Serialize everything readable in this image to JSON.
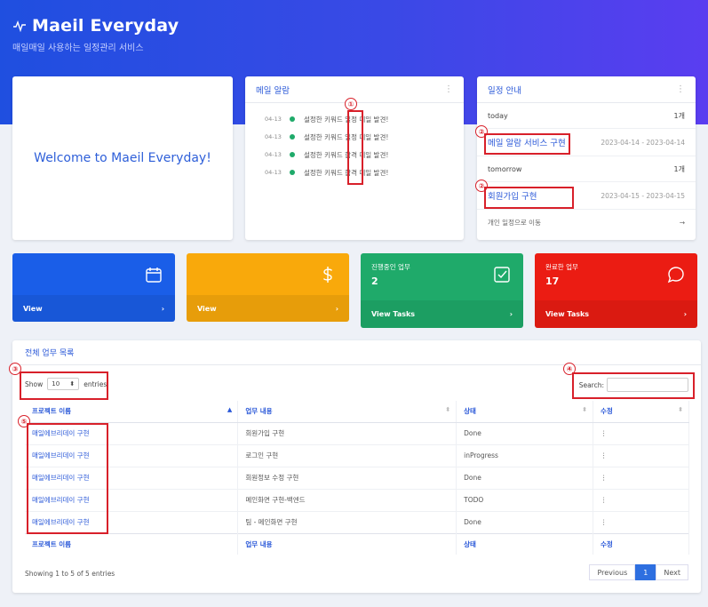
{
  "app": {
    "title": "Maeil Everyday",
    "subtitle": "매일매일 사용하는 일정관리 서비스"
  },
  "welcome": {
    "text": "Welcome to Maeil Everyday!"
  },
  "alarm": {
    "title": "메일 알람",
    "items": [
      {
        "date": "04-13",
        "before": "설정한 키워드 ",
        "keyword": "일정",
        "after": " 메일 발견!"
      },
      {
        "date": "04-13",
        "before": "설정한 키워드 ",
        "keyword": "일정",
        "after": " 메일 발견!"
      },
      {
        "date": "04-13",
        "before": "설정한 키워드 ",
        "keyword": "합격",
        "after": " 메일 발견!"
      },
      {
        "date": "04-13",
        "before": "설정한 키워드 ",
        "keyword": "합격",
        "after": " 메일 발견!"
      }
    ]
  },
  "schedule": {
    "title": "일정 안내",
    "today_label": "today",
    "today_count": "1개",
    "today_item": {
      "title": "메일 알람 서비스 구현",
      "date": "2023-04-14 - 2023-04-14"
    },
    "tomorrow_label": "tomorrow",
    "tomorrow_count": "1개",
    "tomorrow_item": {
      "title": "회원가입 구현",
      "date": "2023-04-15 - 2023-04-15"
    },
    "footer": "개인 일정으로 이동",
    "footer_arrow": "→"
  },
  "tiles": [
    {
      "color": "#1a5ee8",
      "label": "",
      "count": "",
      "view": "View",
      "icon": "calendar-icon"
    },
    {
      "color": "#f9a90b",
      "label": "",
      "count": "",
      "view": "View",
      "icon": "dollar-icon"
    },
    {
      "color": "#1faa6a",
      "label": "진행중인 업무",
      "count": "2",
      "view": "View Tasks",
      "icon": "checkbox-icon"
    },
    {
      "color": "#eb1c13",
      "label": "완료한 업무",
      "count": "17",
      "view": "View Tasks",
      "icon": "chat-icon"
    }
  ],
  "tile_chevron": "›",
  "table": {
    "title": "전체 업무 목록",
    "show_label": "Show",
    "entries_value": "10",
    "entries_label": "entries",
    "search_label": "Search:",
    "columns": [
      "프로젝트 이름",
      "업무 내용",
      "상태",
      "수정"
    ],
    "rows": [
      [
        "매일에브리데이 구현",
        "회원가입 구현",
        "Done",
        "⋮"
      ],
      [
        "매일에브리데이 구현",
        "로그인 구현",
        "inProgress",
        "⋮"
      ],
      [
        "매일에브리데이 구현",
        "회원정보 수정 구현",
        "Done",
        "⋮"
      ],
      [
        "매일에브리데이 구현",
        "메인화면 구현-백엔드",
        "TODO",
        "⋮"
      ],
      [
        "매일에브리데이 구현",
        "팀 - 메인화면 구현",
        "Done",
        "⋮"
      ]
    ],
    "info": "Showing 1 to 5 of 5 entries",
    "prev": "Previous",
    "page": "1",
    "next": "Next"
  },
  "annotations": [
    "①",
    "②",
    "②",
    "③",
    "④",
    "⑤"
  ],
  "colors": {
    "banner": "#2c4fe3",
    "link": "#2a58d8",
    "highlight": "#d8202a"
  }
}
